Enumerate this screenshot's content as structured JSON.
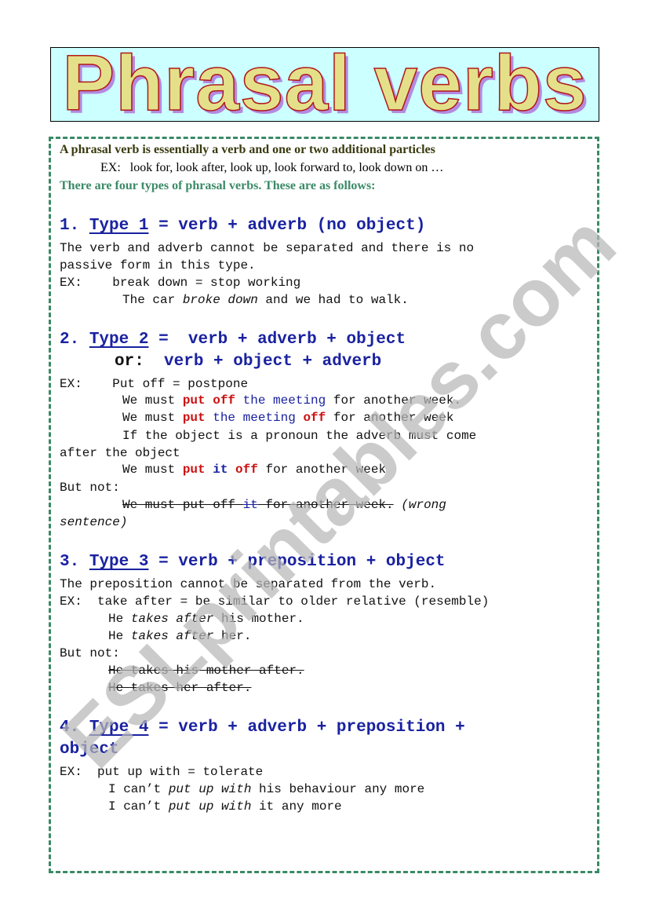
{
  "title": "Phrasal verbs",
  "watermark": "ESLprintables.com",
  "intro": {
    "definition": "A phrasal verb is essentially a verb and one or two additional particles",
    "ex_label": "EX:",
    "examples": "look for, look after, look up, look forward to, look down on …",
    "types_note": "There are four types of phrasal verbs. These are as follows:"
  },
  "sections": [
    {
      "number": "1.",
      "type_label": "Type 1",
      "formula": "= verb + adverb (no object)",
      "lines": [
        "The verb and adverb cannot be separated and there is no",
        "passive form in this type."
      ],
      "ex_label": "EX:",
      "ex_definition": "break down = stop working",
      "ex_sentence": {
        "before": "The car ",
        "italic": "broke down",
        "after": " and we had to walk."
      }
    },
    {
      "number": "2.",
      "type_label": "Type 2",
      "formula": "=  verb + adverb + object",
      "alt_prefix": "or:",
      "alt_formula": "verb + object + adverb",
      "ex_label": "EX:",
      "ex_definition": "Put off = postpone",
      "sentence1": {
        "a": "We must ",
        "b": "put off",
        "c": " the meeting",
        "d": " for another week."
      },
      "sentence2": {
        "a": "We must ",
        "b": "put",
        "c": " the meeting ",
        "d": "off",
        "e": " for another week"
      },
      "pronoun_note_1": "If the object is a pronoun the adverb must come",
      "pronoun_note_2": "after the object",
      "sentence3": {
        "a": "We must ",
        "b": "put",
        "c": "it",
        "d": "off",
        "e": " for another week"
      },
      "but_not": "But not:",
      "wrong": {
        "a": "We must put off ",
        "b": "it",
        "c": " for another week.",
        "note": "(wrong",
        "note2": "sentence)"
      }
    },
    {
      "number": "3.",
      "type_label": "Type 3",
      "formula": "= verb + preposition + object",
      "line": "The preposition cannot be separated from the verb.",
      "ex_label": "EX:",
      "ex_definition": "take after = be similar to older relative (resemble)",
      "s1": {
        "a": "He ",
        "b": "takes after",
        "c": " his mother."
      },
      "s2": {
        "a": "He ",
        "b": "takes after",
        "c": " her."
      },
      "but_not": "But not:",
      "wrong1": "He takes his mother after.",
      "wrong2": "He takes her after."
    },
    {
      "number": "4.",
      "type_label": "Type 4",
      "formula": "= verb + adverb + preposition +",
      "formula2": "object",
      "ex_label": "EX:",
      "ex_definition": "put up with = tolerate",
      "s1": {
        "a": "I can’t ",
        "b": "put up with",
        "c": " his behaviour any more"
      },
      "s2": {
        "a": "I can’t ",
        "b": "put up with",
        "c": " it any more"
      }
    }
  ],
  "colors": {
    "heading_blue": "#1a22a0",
    "emphasis_red": "#cc1111",
    "border_green": "#3a8a66",
    "title_bg": "#ccffff",
    "title_fill": "#e4e08a",
    "title_outline": "#b01818",
    "title_shadow": "#b48ae0"
  }
}
